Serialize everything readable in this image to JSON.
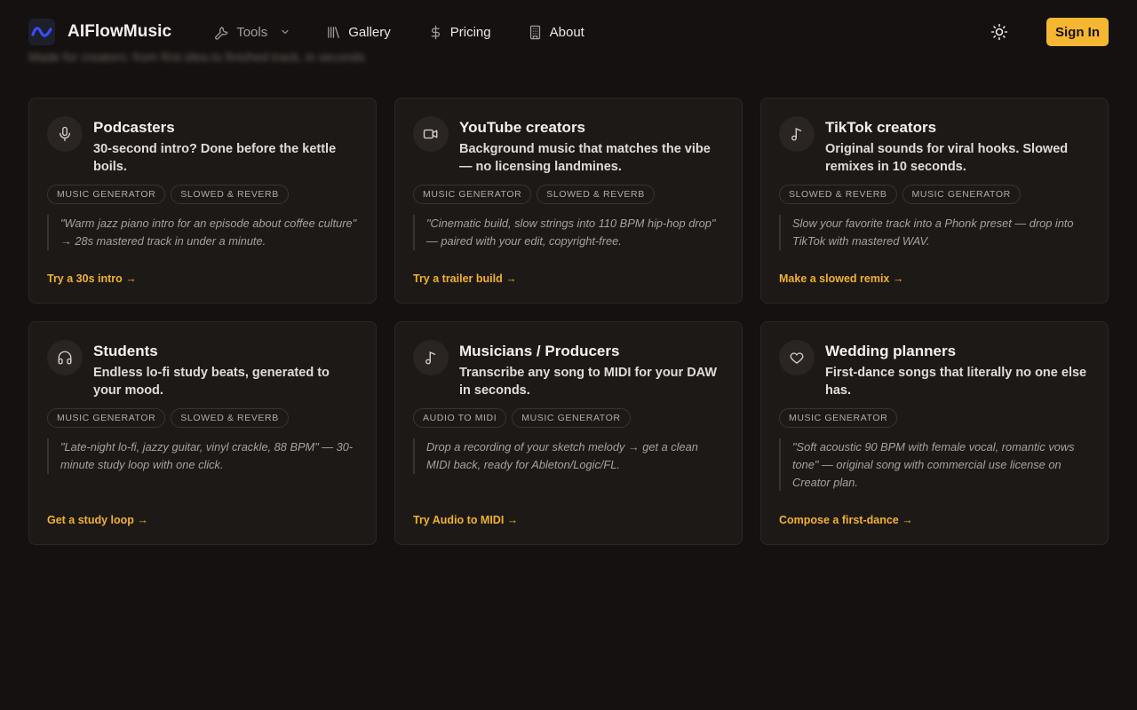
{
  "background_text": "Made for creators: from first idea to finished track, in seconds",
  "header": {
    "brand": "AIFlowMusic",
    "nav": {
      "tools": "Tools",
      "gallery": "Gallery",
      "pricing": "Pricing",
      "about": "About"
    },
    "signin": "Sign In"
  },
  "cards": [
    {
      "title": "Podcasters",
      "desc": "30-second intro? Done before the kettle boils.",
      "tags": [
        "MUSIC GENERATOR",
        "SLOWED & REVERB"
      ],
      "quote": "\"Warm jazz piano intro for an episode about coffee culture\" → 28s mastered track in under a minute.",
      "cta": "Try a 30s intro →",
      "icon": "microphone-icon"
    },
    {
      "title": "YouTube creators",
      "desc": "Background music that matches the vibe — no licensing landmines.",
      "tags": [
        "MUSIC GENERATOR",
        "SLOWED & REVERB"
      ],
      "quote": "\"Cinematic build, slow strings into 110 BPM hip-hop drop\" — paired with your edit, copyright-free.",
      "cta": "Try a trailer build →",
      "icon": "video-camera-icon"
    },
    {
      "title": "TikTok creators",
      "desc": "Original sounds for viral hooks. Slowed remixes in 10 seconds.",
      "tags": [
        "SLOWED & REVERB",
        "MUSIC GENERATOR"
      ],
      "quote": "Slow your favorite track into a Phonk preset — drop into TikTok with mastered WAV.",
      "cta": "Make a slowed remix →",
      "icon": "music-note-icon"
    },
    {
      "title": "Students",
      "desc": "Endless lo-fi study beats, generated to your mood.",
      "tags": [
        "MUSIC GENERATOR",
        "SLOWED & REVERB"
      ],
      "quote": "\"Late-night lo-fi, jazzy guitar, vinyl crackle, 88 BPM\" — 30-minute study loop with one click.",
      "cta": "Get a study loop →",
      "icon": "headphones-icon"
    },
    {
      "title": "Musicians / Producers",
      "desc": "Transcribe any song to MIDI for your DAW in seconds.",
      "tags": [
        "AUDIO TO MIDI",
        "MUSIC GENERATOR"
      ],
      "quote": "Drop a recording of your sketch melody → get a clean MIDI back, ready for Ableton/Logic/FL.",
      "cta": "Try Audio to MIDI →",
      "icon": "music-note-icon"
    },
    {
      "title": "Wedding planners",
      "desc": "First-dance songs that literally no one else has.",
      "tags": [
        "MUSIC GENERATOR"
      ],
      "quote": "\"Soft acoustic 90 BPM with female vocal, romantic vows tone\" — original song with commercial use license on Creator plan.",
      "cta": "Compose a first-dance →",
      "icon": "heart-icon"
    }
  ],
  "colors": {
    "background": "#141110",
    "card": "#1d1917",
    "accent": "#f5b731",
    "logo_wave": "#3b4bff"
  }
}
